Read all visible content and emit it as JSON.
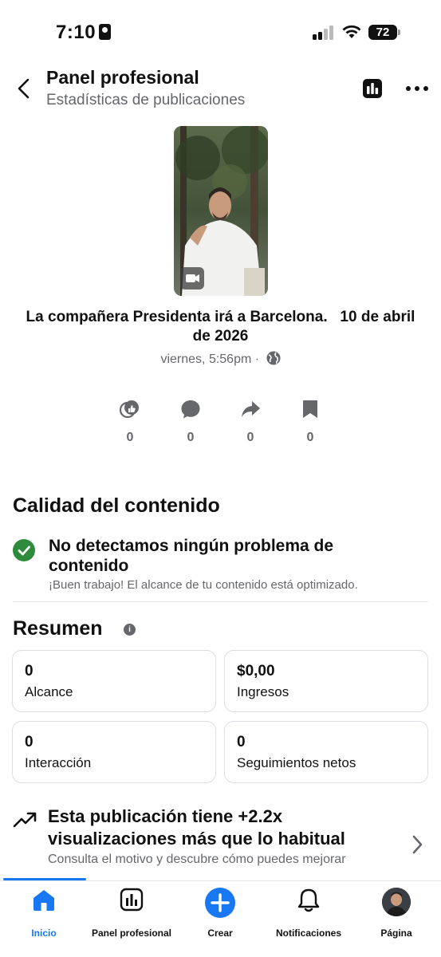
{
  "status_bar": {
    "time": "7:10",
    "battery": "72"
  },
  "header": {
    "title": "Panel profesional",
    "subtitle": "Estadísticas de publicaciones"
  },
  "post": {
    "title": "La compañera Presidenta irá a Barcelona.   10 de abril de 2026",
    "meta": "viernes, 5:56pm ·"
  },
  "reactions": [
    {
      "icon": "reactions-icon",
      "count": "0"
    },
    {
      "icon": "comment-icon",
      "count": "0"
    },
    {
      "icon": "share-icon",
      "count": "0"
    },
    {
      "icon": "bookmark-icon",
      "count": "0"
    }
  ],
  "quality": {
    "heading": "Calidad del contenido",
    "title": "No detectamos ningún problema de contenido",
    "subtitle": "¡Buen trabajo! El alcance de tu contenido está optimizado."
  },
  "summary": {
    "heading": "Resumen",
    "cards": [
      {
        "value": "0",
        "label": "Alcance"
      },
      {
        "value": "$0,00",
        "label": "Ingresos"
      },
      {
        "value": "0",
        "label": "Interacción"
      },
      {
        "value": "0",
        "label": "Seguimientos netos"
      }
    ]
  },
  "insight": {
    "title": "Esta publicación tiene +2.2x visualizaciones más que lo habitual",
    "subtitle": "Consulta el motivo y descubre cómo puedes mejorar"
  },
  "tabs": [
    {
      "label": "Inicio",
      "active": true
    },
    {
      "label": "Panel profesional"
    },
    {
      "label": "Crear"
    },
    {
      "label": "Notificaciones"
    },
    {
      "label": "Página"
    }
  ],
  "colors": {
    "accent": "#1877f2",
    "success": "#2e8b3c",
    "secondary_text": "#65676b"
  }
}
